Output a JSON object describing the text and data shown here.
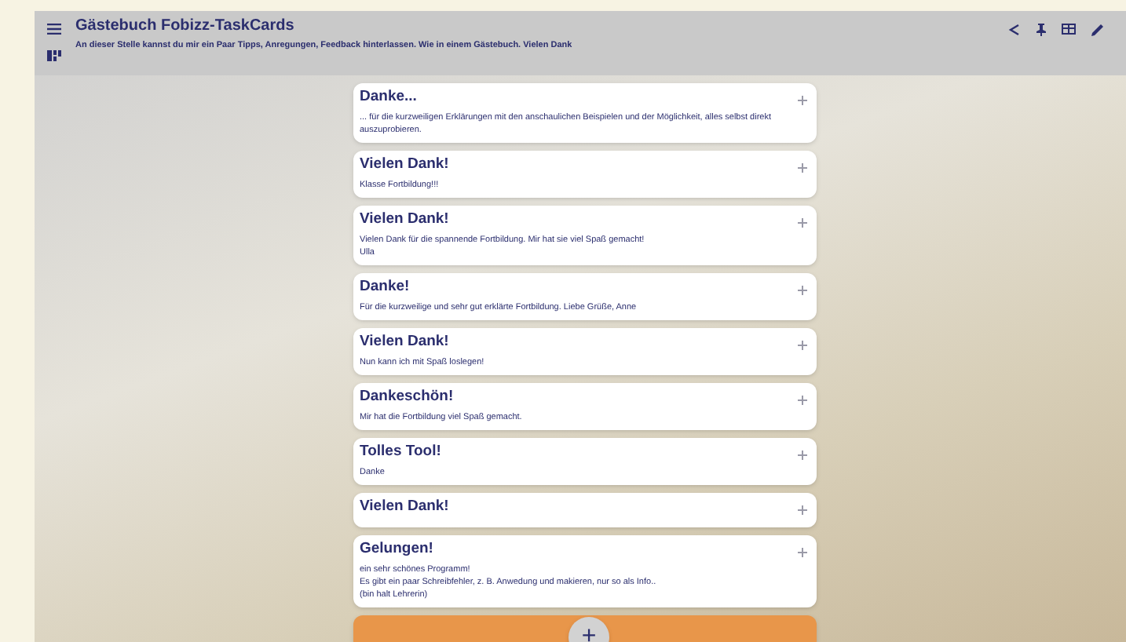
{
  "header": {
    "title": "Gästebuch Fobizz-TaskCards",
    "subtitle": "An dieser Stelle kannst du mir ein Paar Tipps, Anregungen, Feedback hinterlassen. Wie in einem Gästebuch. Vielen Dank"
  },
  "cards": [
    {
      "title": "Danke...",
      "lines": [
        "... für die kurzweiligen Erklärungen mit den anschaulichen Beispielen und der Möglichkeit, alles selbst direkt auszuprobieren."
      ],
      "color": "#ffffff"
    },
    {
      "title": "Vielen Dank!",
      "lines": [
        "Klasse Fortbildung!!!"
      ],
      "color": "#ffffff"
    },
    {
      "title": "Vielen Dank!",
      "lines": [
        "Vielen Dank für die spannende Fortbildung. Mir hat sie viel Spaß gemacht!",
        "Ulla"
      ],
      "color": "#ffffff"
    },
    {
      "title": "Danke!",
      "lines": [
        "Für die kurzweilige und sehr gut erklärte Fortbildung. Liebe Grüße, Anne"
      ],
      "color": "#ffffff"
    },
    {
      "title": "Vielen Dank!",
      "lines": [
        "Nun kann ich mit Spaß loslegen!"
      ],
      "color": "#ffffff"
    },
    {
      "title": "Dankeschön!",
      "lines": [
        "Mir hat die Fortbildung viel Spaß gemacht."
      ],
      "color": "#ffffff"
    },
    {
      "title": "Tolles Tool!",
      "lines": [
        "Danke"
      ],
      "color": "#ffffff"
    },
    {
      "title": "Vielen Dank!",
      "color": "#ffffff"
    },
    {
      "title": "Gelungen!",
      "lines": [
        "ein sehr schönes Programm!",
        "Es gibt ein paar Schreibfehler, z. B. Anwedung und makieren, nur so als Info..",
        "(bin halt Lehrerin)"
      ],
      "color": "#ffffff"
    },
    {
      "color": "#e8964a"
    }
  ],
  "add_button": {
    "label": "+"
  }
}
